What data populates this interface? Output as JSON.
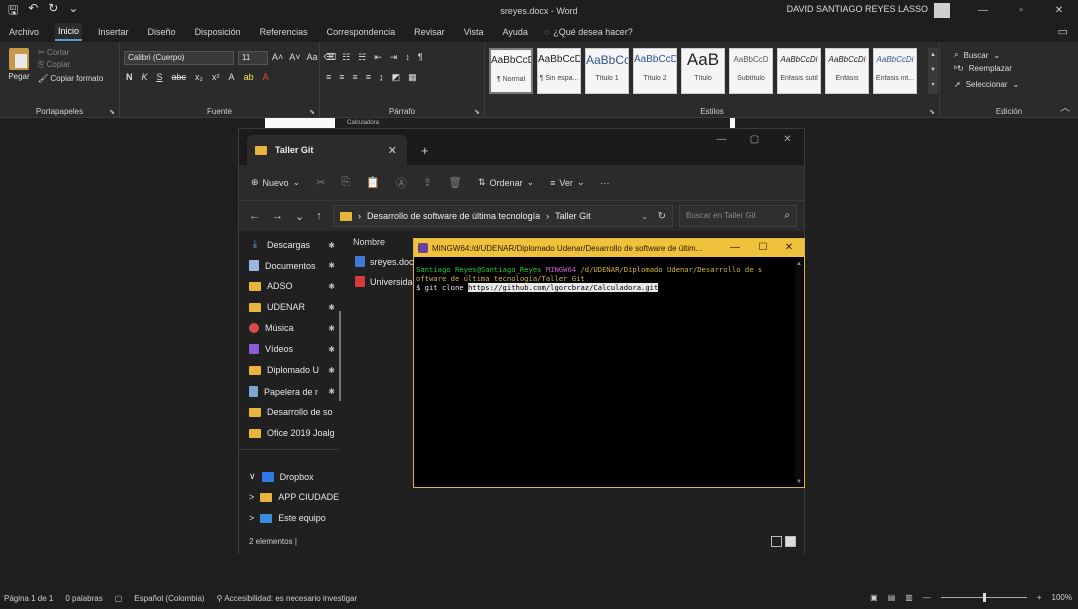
{
  "word": {
    "title": "sreyes.docx - Word",
    "user": "DAVID SANTIAGO REYES LASSO",
    "tabs": [
      "Archivo",
      "Inicio",
      "Insertar",
      "Diseño",
      "Disposición",
      "Referencias",
      "Correspondencia",
      "Revisar",
      "Vista",
      "Ayuda"
    ],
    "tell_me": "¿Qué desea hacer?",
    "clipboard": {
      "paste": "Pegar",
      "cut": "Cortar",
      "copy": "Copiar",
      "format_painter": "Copiar formato",
      "label": "Portapapeles"
    },
    "font": {
      "name": "Calibri (Cuerpo)",
      "size": "11",
      "label": "Fuente"
    },
    "paragraph": {
      "label": "Párrafo"
    },
    "styles": {
      "label": "Estilos",
      "items": [
        {
          "sample": "AaBbCcDc",
          "name": "¶ Normal"
        },
        {
          "sample": "AaBbCcDc",
          "name": "¶ Sin espa..."
        },
        {
          "sample": "AaBbCc",
          "name": "Título 1"
        },
        {
          "sample": "AaBbCcD",
          "name": "Título 2"
        },
        {
          "sample": "AaB",
          "name": "Título"
        },
        {
          "sample": "AaBbCcD",
          "name": "Subtítulo"
        },
        {
          "sample": "AaBbCcDi",
          "name": "Énfasis sutil"
        },
        {
          "sample": "AaBbCcDi",
          "name": "Énfasis"
        },
        {
          "sample": "AaBbCcDi",
          "name": "Énfasis int..."
        }
      ]
    },
    "editing": {
      "find": "Buscar",
      "replace": "Reemplazar",
      "select": "Seleccionar",
      "label": "Edición"
    },
    "page_strip_text": "Calculadora",
    "status": {
      "page": "Página 1 de 1",
      "words": "0 palabras",
      "language": "Español (Colombia)",
      "accessibility": "Accesibilidad: es necesario investigar",
      "zoom": "100%"
    }
  },
  "explorer": {
    "tab_title": "Taller Git",
    "toolbar": {
      "new": "Nuevo",
      "sort": "Ordenar",
      "view": "Ver",
      "more": "···"
    },
    "address": {
      "part1": "Desarrollo de software de última tecnología",
      "part2": "Taller Git"
    },
    "search_placeholder": "Buscar en Taller Git",
    "nav": [
      {
        "label": "Descargas",
        "icon": "download-icon",
        "pinned": true
      },
      {
        "label": "Documentos",
        "icon": "document-icon",
        "pinned": true
      },
      {
        "label": "ADSO",
        "icon": "folder-icon",
        "pinned": true
      },
      {
        "label": "UDENAR",
        "icon": "folder-icon",
        "pinned": true
      },
      {
        "label": "Música",
        "icon": "music-icon",
        "pinned": true
      },
      {
        "label": "Vídeos",
        "icon": "video-icon",
        "pinned": true
      },
      {
        "label": "Diplomado U",
        "icon": "folder-icon",
        "pinned": true
      },
      {
        "label": "Papelera de r",
        "icon": "recycle-bin-icon",
        "pinned": true
      },
      {
        "label": "Desarrollo de so",
        "icon": "folder-icon",
        "pinned": false
      },
      {
        "label": "Ofice 2019 Joalg",
        "icon": "folder-icon",
        "pinned": false
      }
    ],
    "nav_bottom": [
      {
        "label": "Dropbox",
        "icon": "dropbox-icon",
        "chevron": "∨"
      },
      {
        "label": "APP CIUDADE",
        "icon": "folder-icon",
        "chevron": ">"
      },
      {
        "label": "Este equipo",
        "icon": "pc-icon",
        "chevron": ">"
      }
    ],
    "column_name": "Nombre",
    "files": [
      {
        "label": "sreyes.docx",
        "icon": "word-file-icon"
      },
      {
        "label": "Universidad",
        "icon": "pdf-file-icon"
      }
    ],
    "status": "2 elementos"
  },
  "terminal": {
    "title": "MINGW64:/d/UDENAR/Diplomado Udenar/Desarrollo de software de últim...",
    "user": "Santiago Reyes@Santiago_Reyes",
    "env": "MINGW64",
    "path": "/d/UDENAR/Diplomado Udenar/Desarrollo de s",
    "path_cont": "oftware de última tecnología/Taller Git",
    "prompt": "$ git clone ",
    "url": "https://github.com/lgorcbraz/Calculadora.git"
  },
  "colors": {
    "terminal_title_bg": "#f0c23b",
    "term_green": "#27c93f",
    "term_purple": "#c060d0",
    "term_yellow": "#d4b43a",
    "folder": "#e9b43b"
  }
}
